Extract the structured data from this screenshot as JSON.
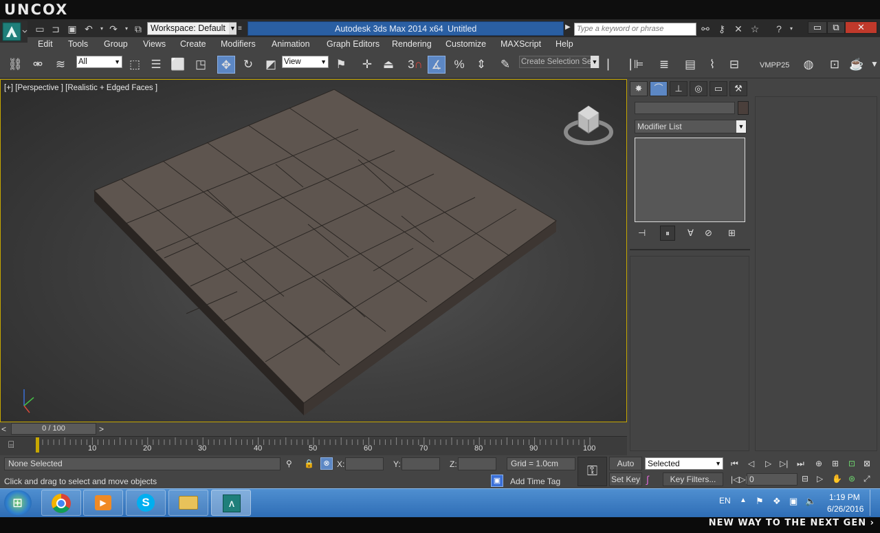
{
  "brand": "UNCOX",
  "tagline": "NEW WAY TO THE NEXT GEN ›",
  "titlebar": {
    "workspace": "Workspace: Default",
    "app_title": "Autodesk 3ds Max  2014 x64",
    "doc_title": "Untitled",
    "search_placeholder": "Type a keyword or phrase"
  },
  "menu": [
    "Edit",
    "Tools",
    "Group",
    "Views",
    "Create",
    "Modifiers",
    "Animation",
    "Graph Editors",
    "Rendering",
    "Customize",
    "MAXScript",
    "Help"
  ],
  "toolbar": {
    "selection_filter": "All",
    "ref_coord": "View",
    "snap_label": "3",
    "named_selection": "Create Selection Se",
    "vmpp": "VMPP25"
  },
  "viewport": {
    "label": "[+] [Perspective ] [Realistic + Edged Faces ]"
  },
  "command_panel": {
    "modifier_list": "Modifier List"
  },
  "timeline": {
    "frame_display": "0 / 100",
    "prev": "<",
    "next": ">",
    "ticks": [
      "10",
      "20",
      "30",
      "40",
      "50",
      "60",
      "70",
      "80",
      "90",
      "100"
    ]
  },
  "status": {
    "selection": "None Selected",
    "prompt": "Click and drag to select and move objects",
    "x_label": "X:",
    "y_label": "Y:",
    "z_label": "Z:",
    "grid": "Grid = 1.0cm",
    "add_time_tag": "Add Time Tag",
    "auto_key": "Auto Key",
    "set_key": "Set Key",
    "key_mode": "Selected",
    "key_filters": "Key Filters...",
    "frame": "0"
  },
  "taskbar": {
    "lang": "EN",
    "time": "1:19 PM",
    "date": "6/26/2016"
  }
}
